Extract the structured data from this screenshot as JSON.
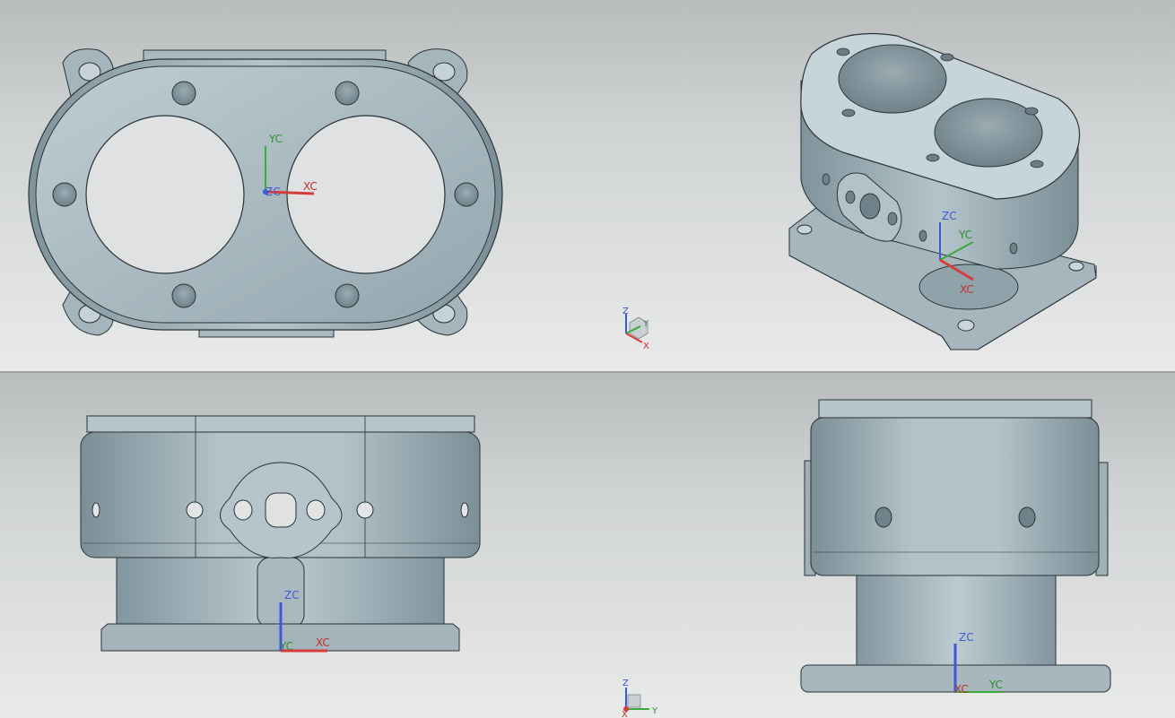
{
  "app": "CAD modeling — four viewport layout",
  "colors": {
    "background_top": "#b9bcbd",
    "background_bottom": "#e9eaea",
    "part_face": "#a8b8bf",
    "part_edge": "#2a3337",
    "axis_x": "#d63c3c",
    "axis_y": "#3caa3c",
    "axis_z": "#3c5ad6"
  },
  "views": {
    "top_left": {
      "xc": "XC",
      "yc": "YC",
      "zc": "ZC"
    },
    "top_right": {
      "xc": "XC",
      "yc": "YC",
      "zc": "ZC"
    },
    "bottom_left": {
      "xc": "XC",
      "yc": "YC",
      "zc": "ZC"
    },
    "bottom_right": {
      "xc": "XC",
      "yc": "YC",
      "zc": "ZC"
    }
  },
  "triad_top": {
    "x": "X",
    "y": "Y",
    "z": "Z"
  },
  "triad_bottom": {
    "x": "X",
    "y": "Y",
    "z": "Z"
  },
  "icons": [
    "view-triad-icon",
    "wcs-icon"
  ]
}
